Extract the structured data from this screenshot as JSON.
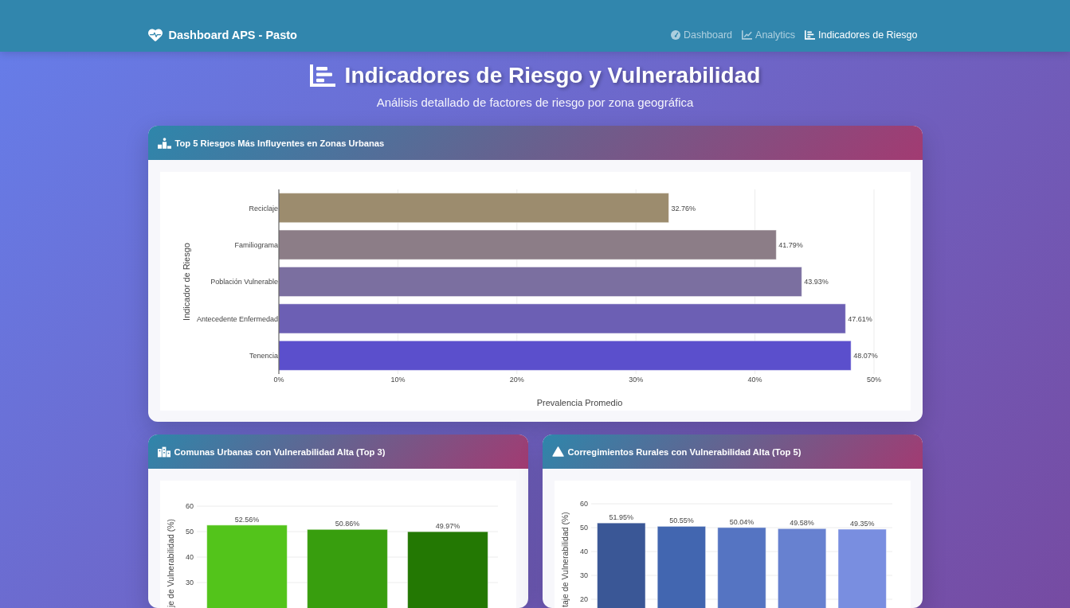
{
  "navbar": {
    "brand": "Dashboard APS - Pasto",
    "items": [
      {
        "label": "Dashboard",
        "selected": false
      },
      {
        "label": "Analytics",
        "selected": false
      },
      {
        "label": "Indicadores de Riesgo",
        "selected": true
      }
    ]
  },
  "header": {
    "title": "Indicadores de Riesgo y Vulnerabilidad",
    "subtitle": "Análisis detallado de factores de riesgo por zona geográfica"
  },
  "cards": [
    {
      "title": "Top 5 Riesgos Más Influyentes en Zonas Urbanas",
      "chart_data": {
        "type": "bar",
        "orientation": "horizontal",
        "grid": true,
        "xlabel": "Prevalencia Promedio",
        "ylabel": "Indicador de Riesgo",
        "categories": [
          "Reciclaje",
          "Familiograma",
          "Población Vulnerable",
          "Antecedente Enfermedad",
          "Tenencia"
        ],
        "values": [
          32.76,
          41.79,
          43.93,
          47.61,
          48.07
        ],
        "colors": [
          "#9c8c6e",
          "#8c7d87",
          "#7b6fa0",
          "#6c5fb4",
          "#5b4fcc"
        ],
        "value_labels": [
          "32.76%",
          "41.79%",
          "43.93%",
          "47.61%",
          "48.07%"
        ],
        "xlim": [
          0,
          50
        ],
        "xticks": [
          {
            "value": 0,
            "label": "0%"
          },
          {
            "value": 10,
            "label": "10%"
          },
          {
            "value": 20,
            "label": "20%"
          },
          {
            "value": 30,
            "label": "30%"
          },
          {
            "value": 40,
            "label": "40%"
          },
          {
            "value": 50,
            "label": "50%"
          }
        ]
      }
    },
    {
      "title": "Comunas Urbanas con Vulnerabilidad Alta (Top 3)",
      "chart_data": {
        "type": "bar",
        "orientation": "vertical",
        "grid": true,
        "ylabel": "je de Vulnerabilidad (%)",
        "values": [
          52.56,
          50.86,
          49.97
        ],
        "colors": [
          "#53c41b",
          "#389e0e",
          "#237803"
        ],
        "value_labels": [
          "52.56%",
          "50.86%",
          "49.97%"
        ],
        "ylim": [
          0,
          60
        ],
        "yticks": [
          30,
          40,
          50,
          60
        ]
      }
    },
    {
      "title": "Corregimientos Rurales con Vulnerabilidad Alta (Top 5)",
      "chart_data": {
        "type": "bar",
        "orientation": "vertical",
        "grid": true,
        "ylabel": "taje de Vulnerabilidad (%)",
        "values": [
          51.95,
          50.55,
          50.04,
          49.58,
          49.35
        ],
        "colors": [
          "#3a5796",
          "#4266b0",
          "#5574c2",
          "#6781d0",
          "#798ee0"
        ],
        "value_labels": [
          "51.95%",
          "50.55%",
          "50.04%",
          "49.58%",
          "49.35%"
        ],
        "ylim": [
          0,
          60
        ],
        "yticks": [
          20,
          30,
          40,
          50,
          60
        ]
      }
    }
  ]
}
